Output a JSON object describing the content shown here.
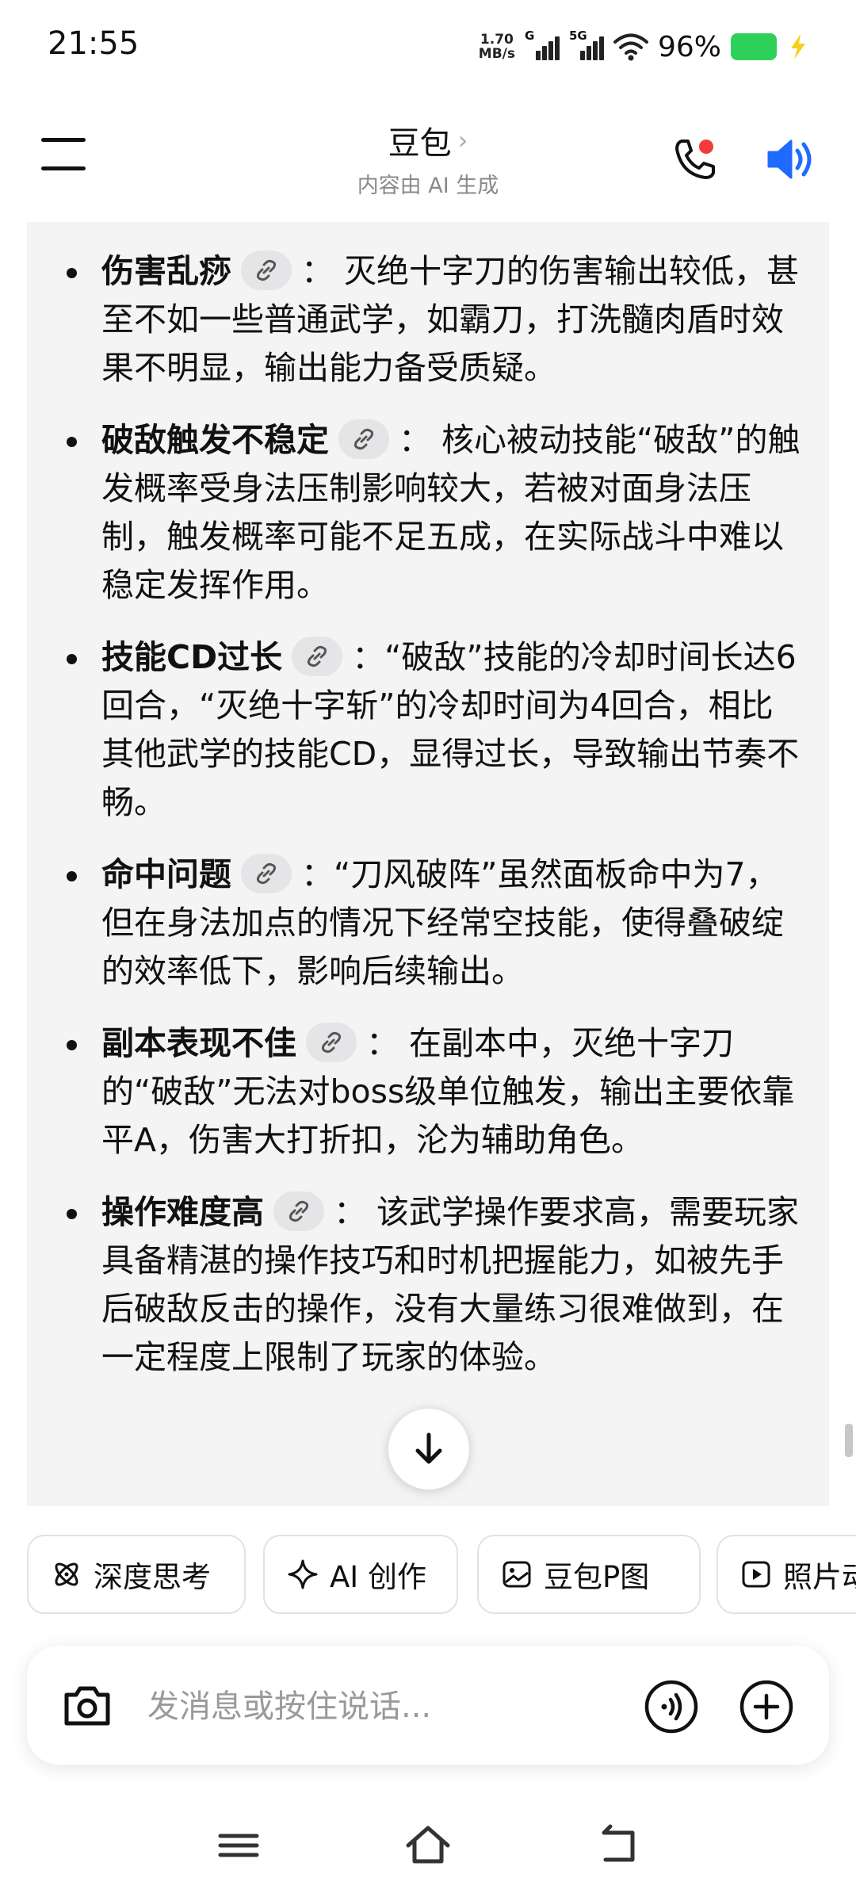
{
  "status": {
    "time": "21:55",
    "net_speed_value": "1.70",
    "net_speed_unit": "MB/s",
    "sim1": "G",
    "sim2": "5G",
    "battery": "96%",
    "battery_color": "#2fd05a"
  },
  "header": {
    "title": "豆包",
    "subtitle": "内容由 AI 生成",
    "notification_color": "#f23b3b",
    "speaker_color": "#1f6bff"
  },
  "points": [
    {
      "term": "伤害乱痧",
      "text": "：  灭绝十字刀的伤害输出较低，甚至不如一些普通武学，如霸刀，打洗髓肉盾时效果不明显，输出能力备受质疑。"
    },
    {
      "term": "破敌触发不稳定",
      "text": "：  核心被动技能“破敌”的触发概率受身法压制影响较大，若被对面身法压制，触发概率可能不足五成，在实际战斗中难以稳定发挥作用。"
    },
    {
      "term": "技能CD过长",
      "text": "：“破敌”技能的冷却时间长达6回合，“灭绝十字斩”的冷却时间为4回合，相比其他武学的技能CD，显得过长，导致输出节奏不畅。"
    },
    {
      "term": "命中问题",
      "text": "：“刀风破阵”虽然面板命中为7，但在身法加点的情况下经常空技能，使得叠破绽的效率低下，影响后续输出。"
    },
    {
      "term": "副本表现不佳",
      "text": "：  在副本中，灭绝十字刀的“破敌”无法对boss级单位触发，输出主要依靠平A，伤害大打折扣，沦为辅助角色。"
    },
    {
      "term": "操作难度高",
      "text": "：  该武学操作要求高，需要玩家具备精湛的操作技巧和时机把握能力，如被先手后破敌反击的操作，没有大量练习很难做到，在一定程度上限制了玩家的体验。"
    }
  ],
  "chips": [
    {
      "label": "深度思考",
      "icon": "atom-icon"
    },
    {
      "label": "AI 创作",
      "icon": "sparkle-icon"
    },
    {
      "label": "豆包P图",
      "icon": "image-edit-icon"
    },
    {
      "label": "照片动起来",
      "icon": "play-icon"
    }
  ],
  "input": {
    "placeholder": "发消息或按住说话..."
  }
}
